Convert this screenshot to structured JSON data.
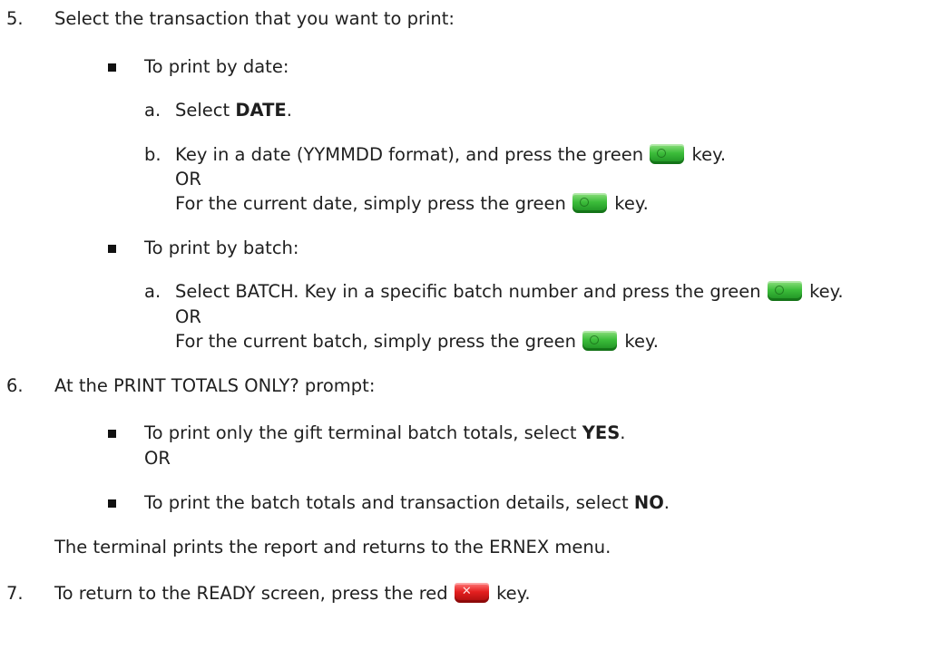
{
  "steps": {
    "step5": {
      "number": "5.",
      "text": "Select the transaction that you want to print:",
      "by_date": {
        "label": "To print by date:",
        "a_letter": "a.",
        "a_prefix": "Select ",
        "a_bold": "DATE",
        "a_suffix": ".",
        "b_letter": "b.",
        "b_prefix": "Key in a date (YYMMDD format), and press the green",
        "b_suffix": "key.",
        "or": "OR",
        "current_prefix": "For the current date, simply press the green",
        "current_suffix": "key."
      },
      "by_batch": {
        "label": "To print by batch:",
        "a_letter": "a.",
        "a_prefix": "Select BATCH. Key in a specific batch number and press the green",
        "a_suffix": "key.",
        "or": "OR",
        "current_prefix": "For the current batch, simply press the green",
        "current_suffix": "key."
      }
    },
    "step6": {
      "number": "6.",
      "text": "At the PRINT TOTALS ONLY? prompt:",
      "opt1_prefix": "To print only the gift terminal batch totals, select ",
      "opt1_bold": "YES",
      "opt1_suffix": ".",
      "or": "OR",
      "opt2_prefix": "To print the batch totals and transaction details, select ",
      "opt2_bold": "NO",
      "opt2_suffix": ".",
      "result": "The terminal prints the report and returns to the ERNEX menu."
    },
    "step7": {
      "number": "7.",
      "prefix": "To return to the READY screen, press the red",
      "suffix": "key."
    }
  },
  "icons": {
    "green_key": "green-enter-key-icon",
    "red_key": "red-cancel-key-icon"
  },
  "colors": {
    "text": "#1f1f1f",
    "green_key": "#3cbd3a",
    "red_key": "#e41f1f"
  }
}
